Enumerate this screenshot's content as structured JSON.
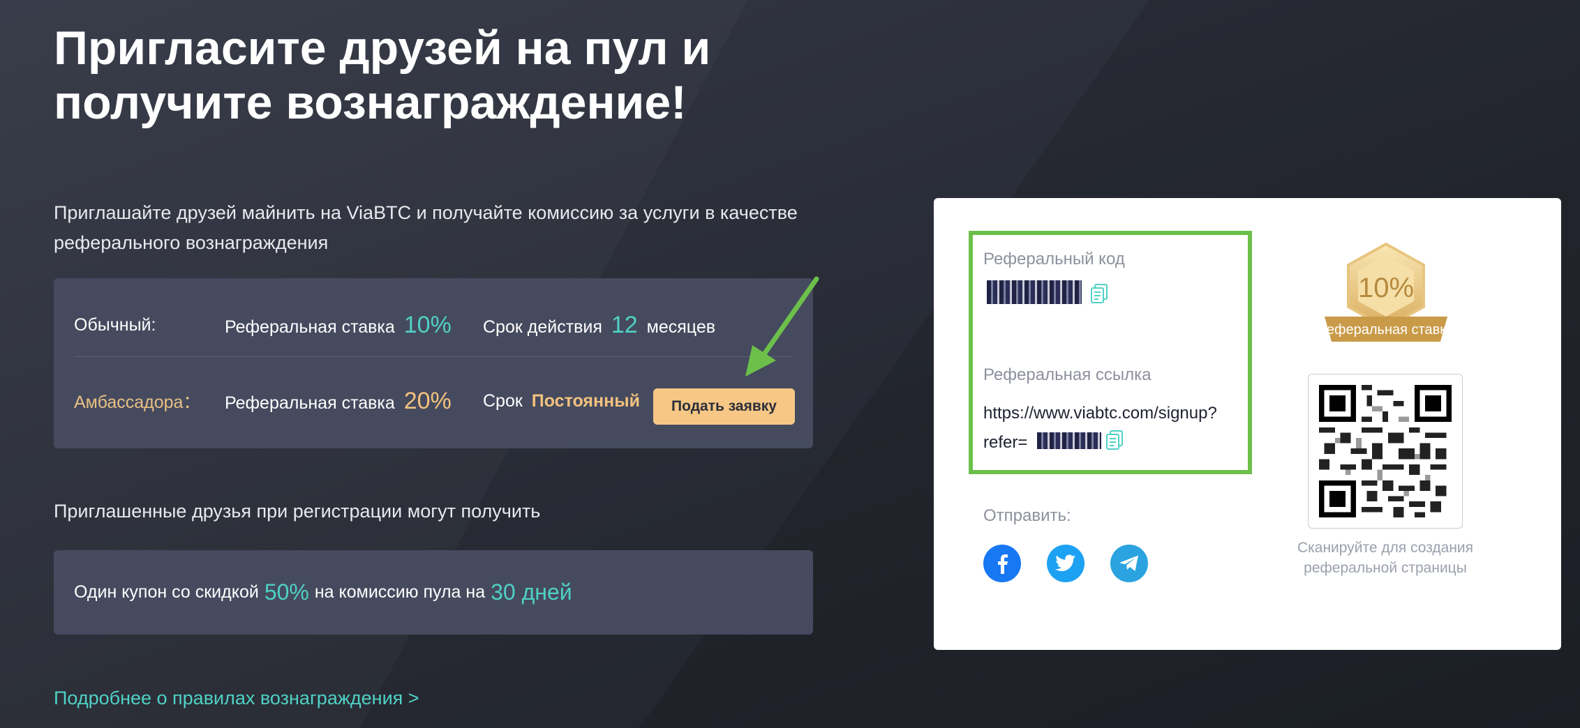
{
  "title": {
    "line1": "Пригласите друзей на пул и",
    "line2": "получите вознаграждение!"
  },
  "intro": "Приглашайте друзей майнить на ViaBTC и получайте комиссию за услуги в качестве реферального вознаграждения",
  "rates": {
    "regular": {
      "label": "Обычный:",
      "rate_label": "Реферальная ставка",
      "rate_value": "10%",
      "term_label": "Срок действия",
      "term_value": "12",
      "term_unit": "месяцев"
    },
    "ambassador": {
      "label": "Амбассадора：",
      "rate_label": "Реферальная ставка",
      "rate_value": "20%",
      "term_label": "Срок",
      "term_value": "Постоянный",
      "apply_button": "Подать заявку"
    }
  },
  "friends": {
    "title": "Приглашенные друзья при регистрации могут получить",
    "coupon_prefix": "Один купон со скидкой",
    "coupon_discount": "50%",
    "coupon_middle": "на комиссию пула на",
    "coupon_duration": "30 дней"
  },
  "rules_link": "Подробнее о правилах вознаграждения >",
  "card": {
    "code_label": "Реферальный код",
    "link_label": "Реферальная ссылка",
    "link_line1": "https://www.viabtc.com/signup?",
    "link_line2": "refer=",
    "share_label": "Отправить:",
    "social": [
      "facebook-icon",
      "twitter-icon",
      "telegram-icon"
    ],
    "badge_percent": "10%",
    "badge_ribbon": "Реферальная ставка",
    "qr_caption": "Сканируйте для создания реферальной страницы"
  },
  "colors": {
    "accent_teal": "#4fd1c5",
    "accent_gold": "#f2c27f",
    "highlight_green": "#6cc04a",
    "facebook": "#1877f2",
    "twitter": "#1da1f2",
    "telegram": "#2aa3e0"
  }
}
